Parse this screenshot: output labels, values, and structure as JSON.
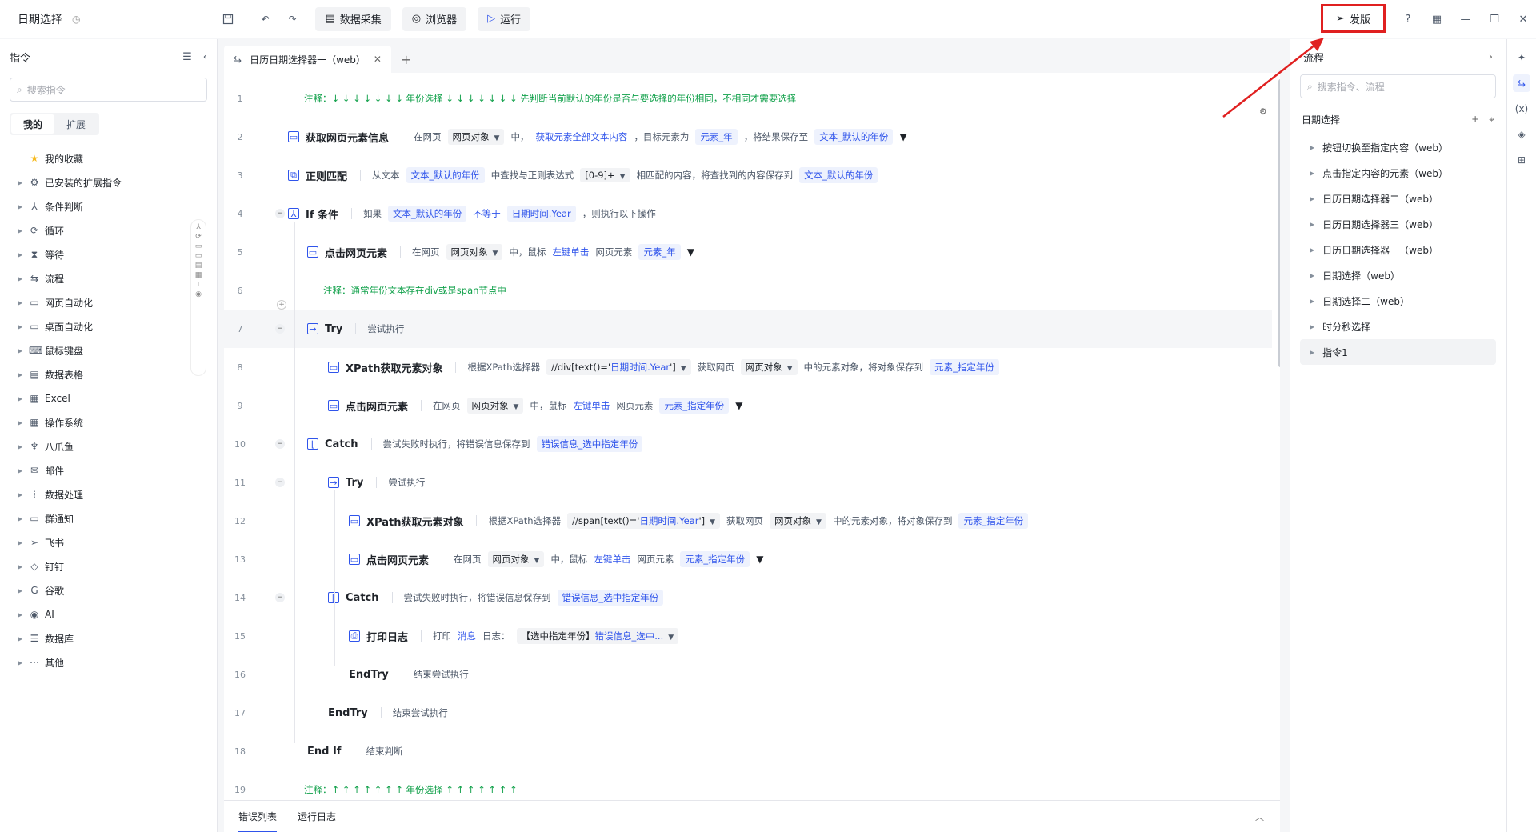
{
  "app": {
    "title": "日期选择",
    "history_icon": "history-icon"
  },
  "toolbar": {
    "data_collect": "数据采集",
    "browser": "浏览器",
    "run": "运行",
    "publish": "发版"
  },
  "left": {
    "title": "指令",
    "search_placeholder": "搜索指令",
    "tabs": [
      "我的",
      "扩展"
    ],
    "categories": [
      {
        "label": "我的收藏",
        "icon": "star-icon"
      },
      {
        "label": "已安装的扩展指令",
        "icon": "extension-icon"
      },
      {
        "label": "条件判断",
        "icon": "branch-icon"
      },
      {
        "label": "循环",
        "icon": "loop-icon"
      },
      {
        "label": "等待",
        "icon": "hourglass-icon"
      },
      {
        "label": "流程",
        "icon": "flow-icon"
      },
      {
        "label": "网页自动化",
        "icon": "web-icon"
      },
      {
        "label": "桌面自动化",
        "icon": "desktop-icon"
      },
      {
        "label": "鼠标键盘",
        "icon": "keyboard-icon"
      },
      {
        "label": "数据表格",
        "icon": "table-icon"
      },
      {
        "label": "Excel",
        "icon": "excel-icon"
      },
      {
        "label": "操作系统",
        "icon": "os-icon"
      },
      {
        "label": "八爪鱼",
        "icon": "octopus-icon"
      },
      {
        "label": "邮件",
        "icon": "mail-icon"
      },
      {
        "label": "数据处理",
        "icon": "data-icon"
      },
      {
        "label": "群通知",
        "icon": "notify-icon"
      },
      {
        "label": "飞书",
        "icon": "feishu-icon"
      },
      {
        "label": "钉钉",
        "icon": "dingtalk-icon"
      },
      {
        "label": "谷歌",
        "icon": "google-icon"
      },
      {
        "label": "AI",
        "icon": "ai-icon"
      },
      {
        "label": "数据库",
        "icon": "database-icon"
      },
      {
        "label": "其他",
        "icon": "more-icon"
      }
    ]
  },
  "editor": {
    "tab_label": "日历日期选择器一（web）",
    "lines": [
      {
        "n": "1",
        "comment": "注释：↓ ↓ ↓ ↓ ↓ ↓ ↓  年份选择  ↓ ↓ ↓ ↓ ↓ ↓ ↓  先判断当前默认的年份是否与要选择的年份相同，不相同才需要选择"
      },
      {
        "n": "2",
        "name": "获取网页元素信息",
        "p1": "在网页",
        "s1": "网页对象",
        "p2": "中，",
        "l1": "获取元素全部文本内容",
        "p3": "，目标元素为",
        "v1": "元素_年",
        "p4": "，将结果保存至",
        "v2": "文本_默认的年份"
      },
      {
        "n": "3",
        "name": "正则匹配",
        "p1": "从文本",
        "v1": "文本_默认的年份",
        "p2": "中查找与正则表达式",
        "s1": "[0-9]+",
        "p3": "相匹配的内容，将查找到的内容保存到",
        "v2": "文本_默认的年份"
      },
      {
        "n": "4",
        "name": "If 条件",
        "p1": "如果",
        "v1": "文本_默认的年份",
        "l1": "不等于",
        "v2": "日期时间.Year",
        "p2": "，则执行以下操作"
      },
      {
        "n": "5",
        "name": "点击网页元素",
        "p1": "在网页",
        "s1": "网页对象",
        "p2": "中，鼠标",
        "l1": "左键单击",
        "p3": "网页元素",
        "v1": "元素_年"
      },
      {
        "n": "6",
        "comment": "注释：通常年份文本存在div或是span节点中"
      },
      {
        "n": "7",
        "name": "Try",
        "p1": "尝试执行"
      },
      {
        "n": "8",
        "name": "XPath获取元素对象",
        "p1": "根据XPath选择器",
        "x1": "//div[text()='",
        "x2": "日期时间.Year",
        "x3": "']",
        "p2": "获取网页",
        "s1": "网页对象",
        "p3": "中的元素对象，将对象保存到",
        "v1": "元素_指定年份"
      },
      {
        "n": "9",
        "name": "点击网页元素",
        "p1": "在网页",
        "s1": "网页对象",
        "p2": "中，鼠标",
        "l1": "左键单击",
        "p3": "网页元素",
        "v1": "元素_指定年份"
      },
      {
        "n": "10",
        "name": "Catch",
        "p1": "尝试失败时执行，将错误信息保存到",
        "v1": "错误信息_选中指定年份"
      },
      {
        "n": "11",
        "name": "Try",
        "p1": "尝试执行"
      },
      {
        "n": "12",
        "name": "XPath获取元素对象",
        "p1": "根据XPath选择器",
        "x1": "//span[text()='",
        "x2": "日期时间.Year",
        "x3": "']",
        "p2": "获取网页",
        "s1": "网页对象",
        "p3": "中的元素对象，将对象保存到",
        "v1": "元素_指定年份"
      },
      {
        "n": "13",
        "name": "点击网页元素",
        "p1": "在网页",
        "s1": "网页对象",
        "p2": "中，鼠标",
        "l1": "左键单击",
        "p3": "网页元素",
        "v1": "元素_指定年份"
      },
      {
        "n": "14",
        "name": "Catch",
        "p1": "尝试失败时执行，将错误信息保存到",
        "v1": "错误信息_选中指定年份"
      },
      {
        "n": "15",
        "name": "打印日志",
        "p1": "打印",
        "l1": "消息",
        "p2": "日志：",
        "x1": "【选中指定年份】",
        "x2": "错误信息_选中..."
      },
      {
        "n": "16",
        "name": "EndTry",
        "p1": "结束尝试执行"
      },
      {
        "n": "17",
        "name": "EndTry",
        "p1": "结束尝试执行"
      },
      {
        "n": "18",
        "name": "End If",
        "p1": "结束判断"
      },
      {
        "n": "19",
        "comment": "注释：↑ ↑ ↑ ↑ ↑ ↑ ↑  年份选择  ↑ ↑ ↑ ↑ ↑ ↑ ↑"
      }
    ]
  },
  "bottom": {
    "tabs": [
      "错误列表",
      "运行日志"
    ]
  },
  "right": {
    "title": "流程",
    "search_placeholder": "搜索指令、流程",
    "group": "日期选择",
    "flows": [
      "按钮切换至指定内容（web）",
      "点击指定内容的元素（web）",
      "日历日期选择器二（web）",
      "日历日期选择器三（web）",
      "日历日期选择器一（web）",
      "日期选择（web）",
      "日期选择二（web）",
      "时分秒选择",
      "指令1"
    ]
  },
  "colors": {
    "accent": "#2f54eb",
    "comment": "#12a14b",
    "annotation": "#e02020"
  }
}
